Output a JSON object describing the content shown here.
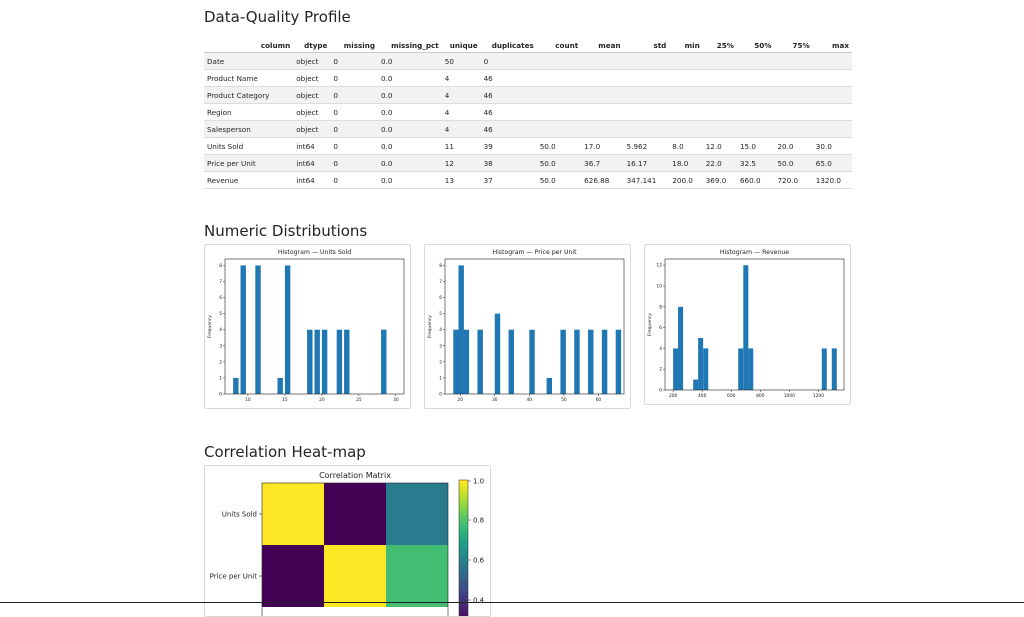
{
  "sections": {
    "profile_title": "Data-Quality Profile",
    "dist_title": "Numeric Distributions",
    "corr_title": "Correlation Heat-map"
  },
  "table": {
    "headers": [
      "column",
      "dtype",
      "missing",
      "missing_pct",
      "unique",
      "duplicates",
      "count",
      "mean",
      "std",
      "min",
      "25%",
      "50%",
      "75%",
      "max"
    ],
    "rows": [
      [
        "Date",
        "object",
        "0",
        "0.0",
        "50",
        "0",
        "",
        "",
        "",
        "",
        "",
        "",
        "",
        ""
      ],
      [
        "Product Name",
        "object",
        "0",
        "0.0",
        "4",
        "46",
        "",
        "",
        "",
        "",
        "",
        "",
        "",
        ""
      ],
      [
        "Product Category",
        "object",
        "0",
        "0.0",
        "4",
        "46",
        "",
        "",
        "",
        "",
        "",
        "",
        "",
        ""
      ],
      [
        "Region",
        "object",
        "0",
        "0.0",
        "4",
        "46",
        "",
        "",
        "",
        "",
        "",
        "",
        "",
        ""
      ],
      [
        "Salesperson",
        "object",
        "0",
        "0.0",
        "4",
        "46",
        "",
        "",
        "",
        "",
        "",
        "",
        "",
        ""
      ],
      [
        "Units Sold",
        "int64",
        "0",
        "0.0",
        "11",
        "39",
        "50.0",
        "17.0",
        "5.962",
        "8.0",
        "12.0",
        "15.0",
        "20.0",
        "30.0"
      ],
      [
        "Price per Unit",
        "int64",
        "0",
        "0.0",
        "12",
        "38",
        "50.0",
        "36.7",
        "16.17",
        "18.0",
        "22.0",
        "32.5",
        "50.0",
        "65.0"
      ],
      [
        "Revenue",
        "int64",
        "0",
        "0.0",
        "13",
        "37",
        "50.0",
        "626.88",
        "347.141",
        "200.0",
        "369.0",
        "660.0",
        "720.0",
        "1320.0"
      ]
    ]
  },
  "chart_data": [
    {
      "type": "bar",
      "title": "Histogram — Units Sold",
      "ylabel": "Frequency",
      "xlim": [
        6.9,
        31.1
      ],
      "ylim": [
        0,
        8.4
      ],
      "xticks": [
        10,
        15,
        20,
        25,
        30
      ],
      "yticks": [
        0,
        1,
        2,
        3,
        4,
        5,
        6,
        7,
        8
      ],
      "bin_width": 0.73,
      "bins": [
        [
          8,
          1
        ],
        [
          9,
          8
        ],
        [
          11,
          8
        ],
        [
          14,
          1
        ],
        [
          15,
          8
        ],
        [
          18,
          4
        ],
        [
          19,
          4
        ],
        [
          20,
          4
        ],
        [
          22,
          4
        ],
        [
          23,
          4
        ],
        [
          28,
          4
        ]
      ]
    },
    {
      "type": "bar",
      "title": "Histogram — Price per Unit",
      "ylabel": "Frequency",
      "xlim": [
        15.6,
        67.4
      ],
      "ylim": [
        0,
        8.4
      ],
      "xticks": [
        20,
        30,
        40,
        50,
        60
      ],
      "yticks": [
        0,
        1,
        2,
        3,
        4,
        5,
        6,
        7,
        8
      ],
      "bin_width": 1.57,
      "bins": [
        [
          18,
          4
        ],
        [
          19.5,
          8
        ],
        [
          21,
          4
        ],
        [
          25,
          4
        ],
        [
          30,
          5
        ],
        [
          34,
          4
        ],
        [
          40,
          4
        ],
        [
          45,
          1
        ],
        [
          49,
          4
        ],
        [
          53,
          4
        ],
        [
          57,
          4
        ],
        [
          61,
          4
        ],
        [
          65,
          4
        ]
      ]
    },
    {
      "type": "bar",
      "title": "Histogram — Revenue",
      "ylabel": "Frequency",
      "xlim": [
        144,
        1376
      ],
      "ylim": [
        0,
        12.6
      ],
      "xticks": [
        200,
        400,
        600,
        800,
        1000,
        1200
      ],
      "yticks": [
        0,
        2,
        4,
        6,
        8,
        10,
        12
      ],
      "bin_width": 34.5,
      "bins": [
        [
          200,
          4
        ],
        [
          234,
          8
        ],
        [
          338,
          1
        ],
        [
          372,
          5
        ],
        [
          407,
          4
        ],
        [
          648,
          4
        ],
        [
          683,
          12
        ],
        [
          717,
          4
        ],
        [
          1223,
          4
        ],
        [
          1292,
          4
        ]
      ]
    },
    {
      "type": "heatmap",
      "title": "Correlation Matrix",
      "rows": [
        "Units Sold",
        "Price per Unit"
      ],
      "matrix": [
        [
          1.0,
          0.28,
          0.58
        ],
        [
          0.28,
          1.0,
          0.78
        ]
      ],
      "colorbar_ticks": [
        "1.0",
        "0.8",
        "0.6",
        "0.4"
      ],
      "colorbar_range": [
        0.28,
        1.0
      ]
    }
  ]
}
